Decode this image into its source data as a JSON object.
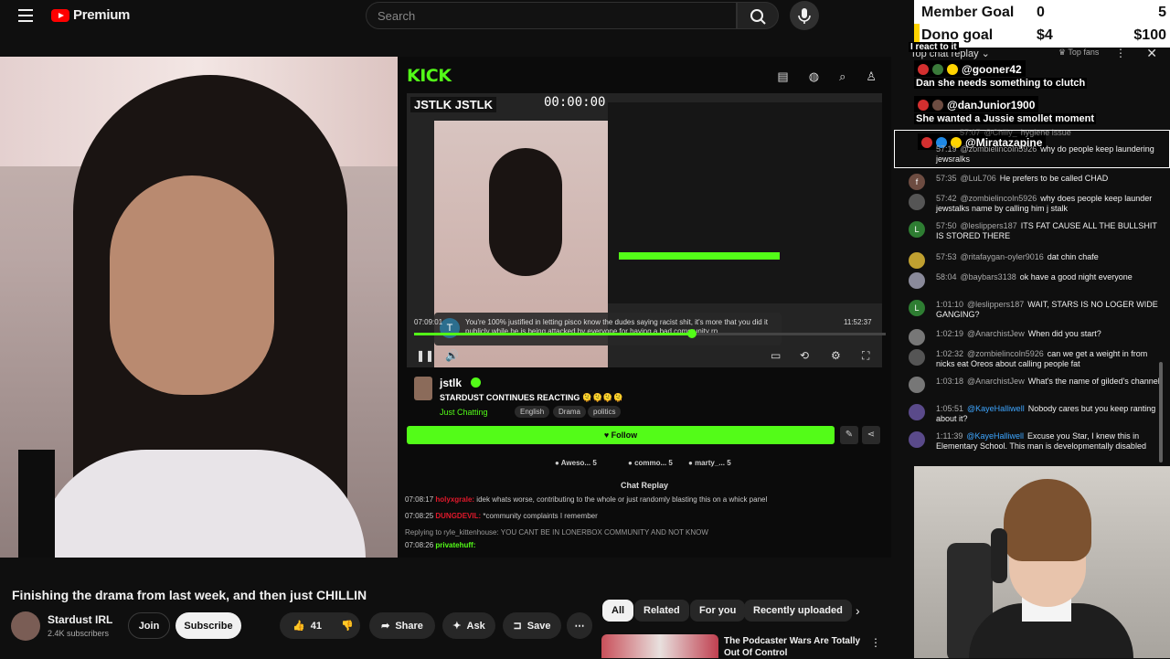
{
  "topbar": {
    "logo_text": "Premium",
    "search_placeholder": "Search"
  },
  "goals": {
    "member_label": "Member Goal",
    "member_current": "0",
    "member_target": "5",
    "dono_label": "Dono goal",
    "dono_current": "$4",
    "dono_target": "$100"
  },
  "video": {
    "kick": {
      "logo": "KICK",
      "inner_tag_1": "JSTLK",
      "inner_tag_2": "JSTLK",
      "timer": "00:00:00",
      "comment_avatar": "T",
      "comment_text": "You're 100% justified in letting pisco know the dudes saying racist shit, it's more that you did it publicly while he is being attacked by everyone for having a bad community rn",
      "time_current": "07:09:01",
      "time_total": "11:52:37",
      "progress": 0.59,
      "streamer_name": "jstlk",
      "stream_title": "STARDUST CONTINUES REACTING 🫠🫠🫠🫠",
      "category": "Just Chatting",
      "tags": [
        "English",
        "Drama",
        "politics"
      ],
      "follow_label": "Follow",
      "fans": [
        "Aweso...",
        "commo...",
        "marty_..."
      ],
      "fans_count": [
        "5",
        "5",
        "5"
      ],
      "chat_replay_label": "Chat Replay",
      "chat": [
        {
          "time": "07:08:17",
          "user": "holyxgrale:",
          "text": "idek whats worse, contributing to the whole or just randomly blasting this on a whick panel"
        },
        {
          "time": "07:08:25",
          "user": "DUNGDEVIL:",
          "text": "*community complaints I remember"
        },
        {
          "time": "",
          "user": "",
          "text": "Replying to ryle_kittenhouse: YOU CANT BE IN LONERBOX COMMUNITY AND NOT KNOW"
        },
        {
          "time": "07:08:26",
          "user": "privatehuff:",
          "text": ""
        }
      ]
    }
  },
  "below": {
    "title": "Finishing the drama from last week, and then just CHILLIN",
    "channel_name": "Stardust IRL",
    "channel_subs": "2.4K subscribers",
    "join_label": "Join",
    "subscribe_label": "Subscribe",
    "like_count": "41",
    "share_label": "Share",
    "ask_label": "Ask",
    "save_label": "Save",
    "chips": [
      "All",
      "Related",
      "For you",
      "Recently uploaded"
    ],
    "rec_title": "The Podcaster Wars Are Totally Out Of Control"
  },
  "chat": {
    "header": "Top chat replay",
    "top_fans": "Top fans",
    "overlay_react": "I react to it",
    "overlay": [
      {
        "user": "@gooner42",
        "text": "Dan she needs something to clutch"
      },
      {
        "user": "@danJunior1900",
        "text": "She wanted a Jussie smollet moment"
      },
      {
        "user": "@Miratazapine",
        "text": ""
      }
    ],
    "messages": [
      {
        "avatar": "",
        "time": "57:07",
        "user": "@Chilly_",
        "text": "hygiene issue",
        "color": "#6b4f3a"
      },
      {
        "avatar": "",
        "time": "57:19",
        "user": "@zombielincoln5926",
        "text": "why do people keep laundering jewsralks",
        "color": "#555555"
      },
      {
        "avatar": "f",
        "time": "57:35",
        "user": "@LuL706",
        "text": "He prefers to be called CHAD",
        "color": "#6d4c41"
      },
      {
        "avatar": "",
        "time": "57:42",
        "user": "@zombielincoln5926",
        "text": "why does people keep launder jewstalks name by calling him j stalk",
        "color": "#555555"
      },
      {
        "avatar": "L",
        "time": "57:50",
        "user": "@leslippers187",
        "text": "ITS FAT CAUSE ALL THE BULLSHIT IS STORED THERE",
        "color": "#2e7d32"
      },
      {
        "avatar": "",
        "time": "57:53",
        "user": "@ritafaygan-oyler9016",
        "text": "dat chin chafe",
        "color": "#c0a030"
      },
      {
        "avatar": "",
        "time": "58:04",
        "user": "@baybars3138",
        "text": "ok have a good night everyone",
        "color": "#8a8a9a"
      },
      {
        "avatar": "L",
        "time": "1:01:10",
        "user": "@leslippers187",
        "text": "WAIT, STARS IS NO LOGER WIDE GANGING?",
        "color": "#2e7d32"
      },
      {
        "avatar": "",
        "time": "1:02:19",
        "user": "@AnarchistJew",
        "text": "When did you start?",
        "color": "#777777"
      },
      {
        "avatar": "",
        "time": "1:02:32",
        "user": "@zombielincoln5926",
        "text": "can we get a weight in from nicks eat Oreos about calling people fat",
        "color": "#555555"
      },
      {
        "avatar": "",
        "time": "1:03:18",
        "user": "@AnarchistJew",
        "text": "What's the name of gilded's channel",
        "color": "#777777"
      },
      {
        "avatar": "",
        "time": "1:05:51",
        "user": "@KayeHalliwell",
        "text": "Nobody cares but you keep ranting about it?",
        "color": "#5a4a8a"
      },
      {
        "avatar": "",
        "time": "1:11:39",
        "user": "@KayeHalliwell",
        "text": "Excuse you Star, I knew this in Elementary School. This man is developmentally disabled",
        "color": "#5a4a8a"
      }
    ]
  },
  "colors": {
    "kick_green": "#53fc18",
    "yt_red": "#ff0000",
    "goal_yellow": "#ffd400"
  }
}
